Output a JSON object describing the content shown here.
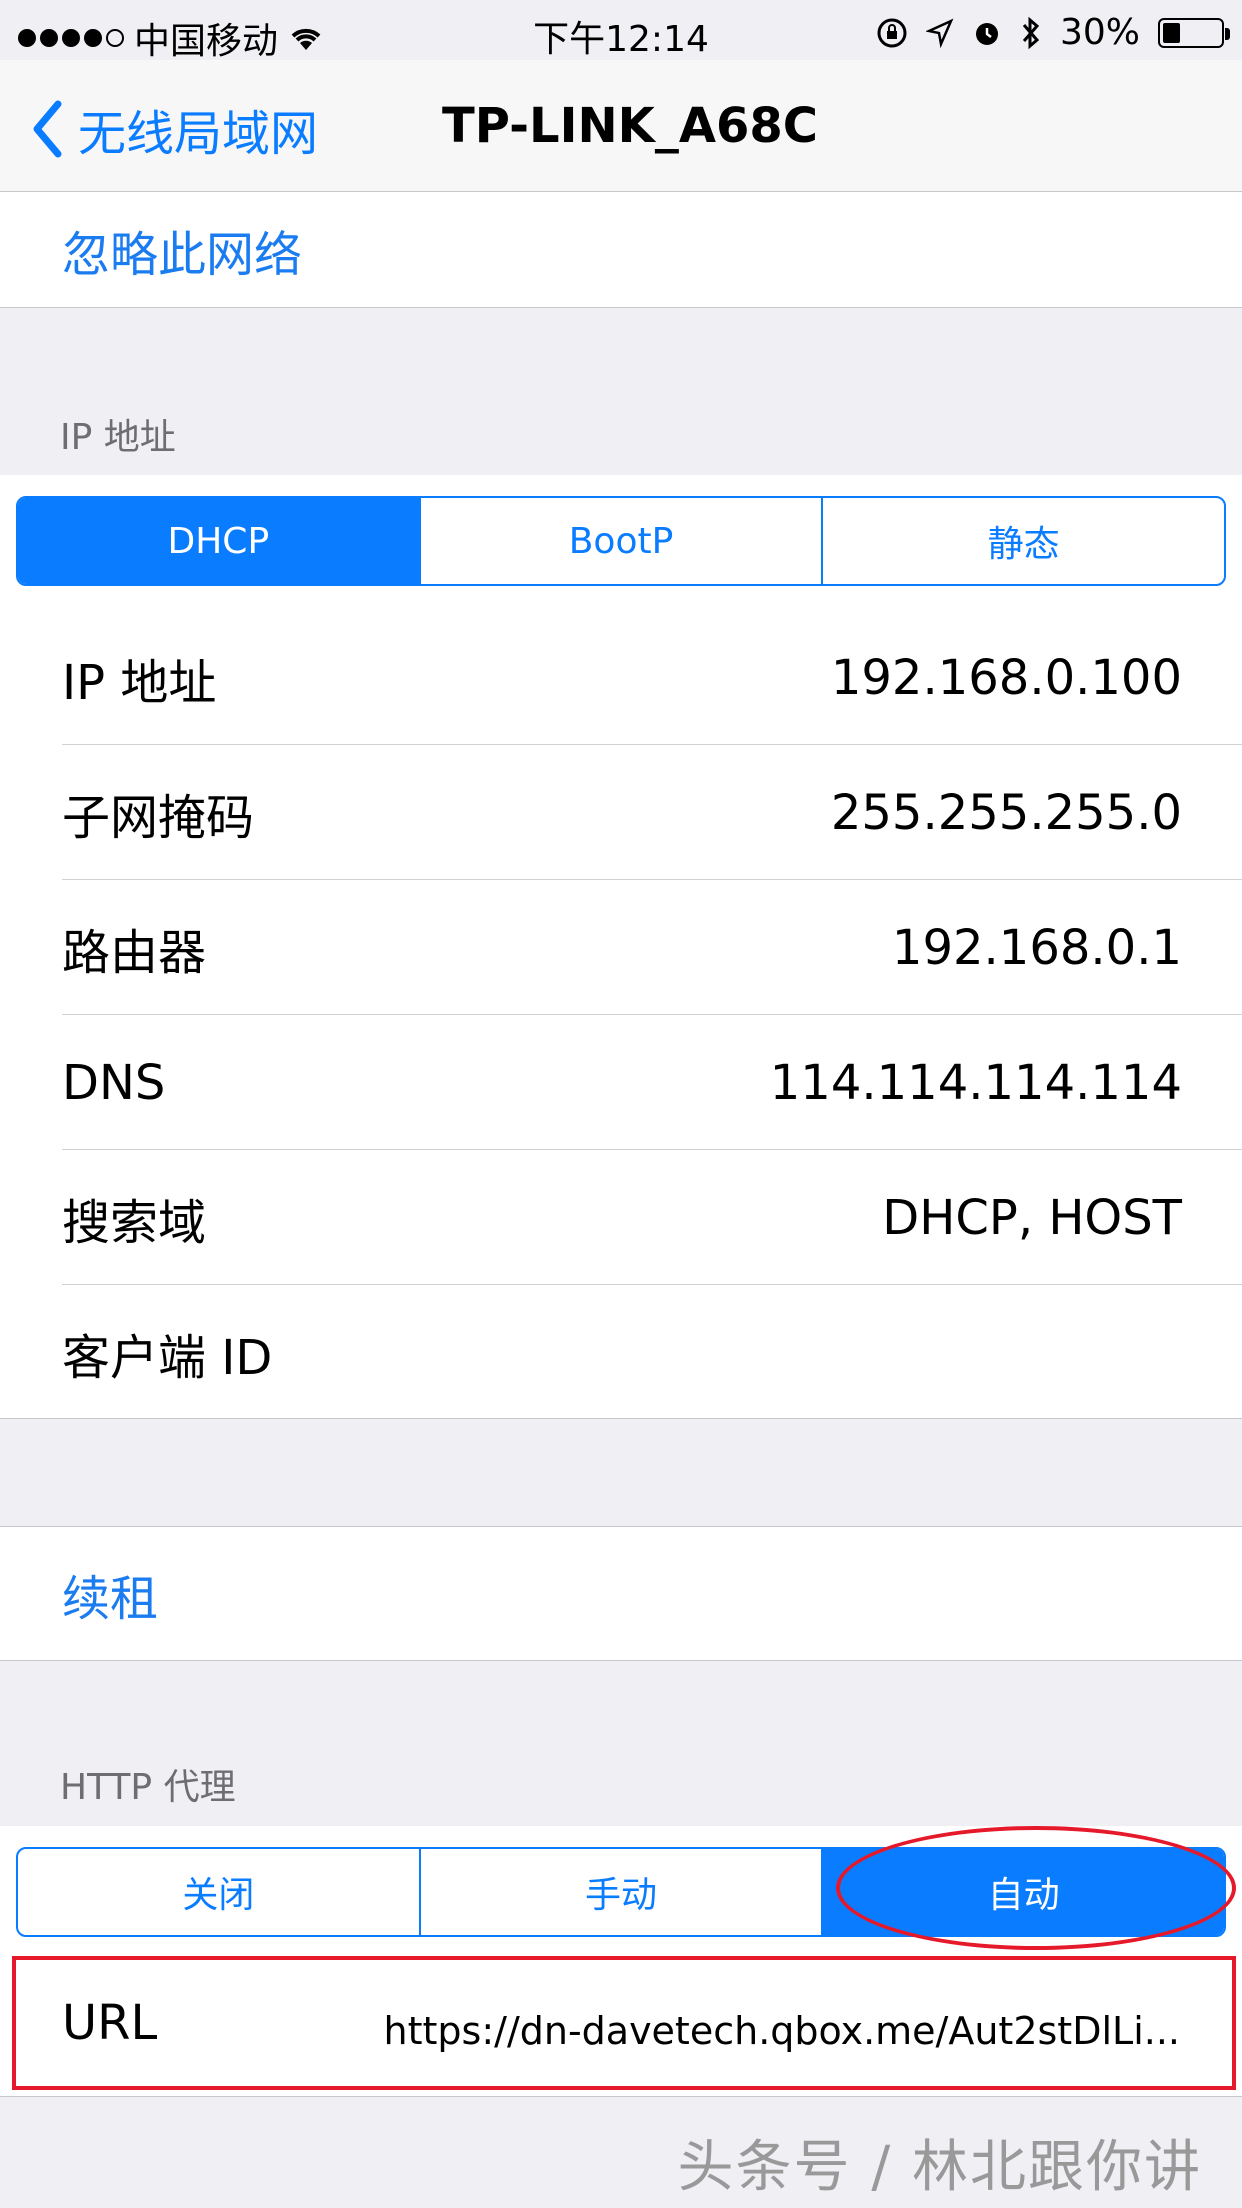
{
  "status_bar": {
    "carrier": "中国移动",
    "time": "下午12:14",
    "battery_percent": "30%",
    "battery_level": 0.3
  },
  "nav": {
    "back_label": "无线局域网",
    "title": "TP-LINK_A68C"
  },
  "forget_network": "忽略此网络",
  "ip_section": {
    "header": "IP 地址",
    "segments": [
      "DHCP",
      "BootP",
      "静态"
    ],
    "selected": "DHCP",
    "rows": [
      {
        "label": "IP 地址",
        "value": "192.168.0.100"
      },
      {
        "label": "子网掩码",
        "value": "255.255.255.0"
      },
      {
        "label": "路由器",
        "value": "192.168.0.1"
      },
      {
        "label": "DNS",
        "value": "114.114.114.114"
      },
      {
        "label": "搜索域",
        "value": "DHCP, HOST"
      },
      {
        "label": "客户端 ID",
        "value": ""
      }
    ]
  },
  "renew_lease": "续租",
  "proxy_section": {
    "header": "HTTP 代理",
    "segments": [
      "关闭",
      "手动",
      "自动"
    ],
    "selected": "自动",
    "url_label": "URL",
    "url_value": "https://dn-davetech.qbox.me/Aut2stDlLi..."
  },
  "watermark": "头条号 / 林北跟你讲",
  "colors": {
    "accent": "#0a7cff",
    "annotation": "#e5192a",
    "background": "#efeff4"
  }
}
